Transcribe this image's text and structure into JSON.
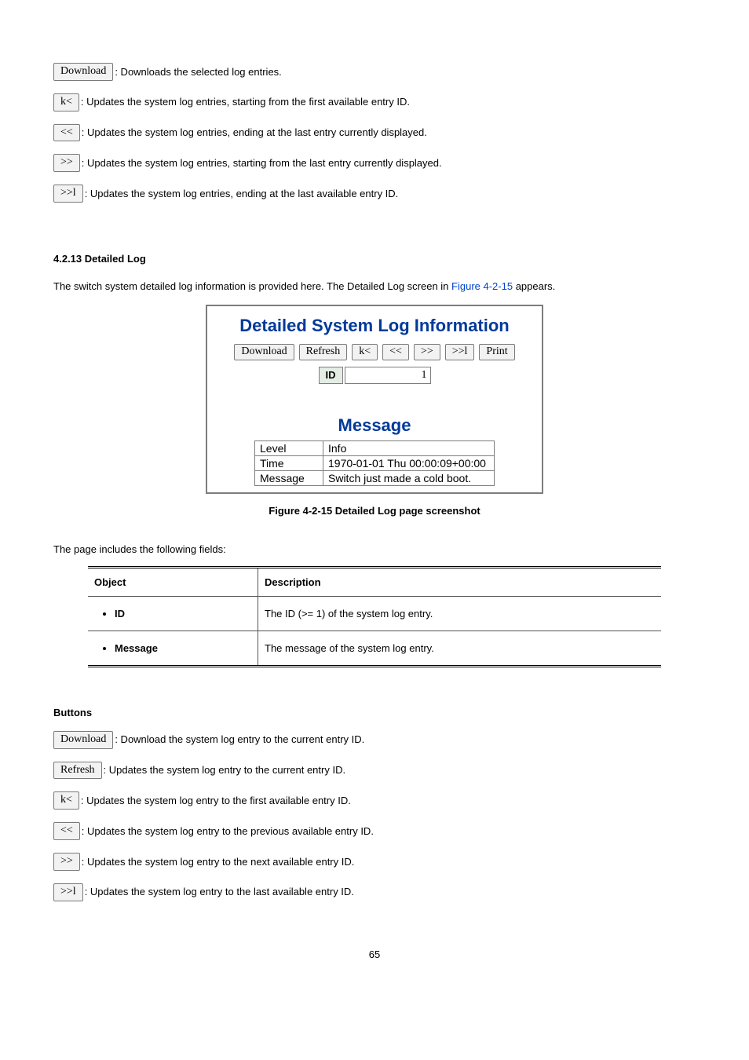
{
  "top_buttons": [
    {
      "label": "Download",
      "desc": ": Downloads the selected log entries."
    },
    {
      "label": "k<",
      "desc": ": Updates the system log entries, starting from the first available entry ID."
    },
    {
      "label": "<<",
      "desc": ": Updates the system log entries, ending at the last entry currently displayed."
    },
    {
      "label": ">>",
      "desc": ": Updates the system log entries, starting from the last entry currently displayed."
    },
    {
      "label": ">>l",
      "desc": ": Updates the system log entries, ending at the last available entry ID."
    }
  ],
  "section_heading": "4.2.13 Detailed Log",
  "intro_prefix": "The switch system detailed log information is provided here. The Detailed Log screen in ",
  "intro_link": "Figure 4-2-15",
  "intro_suffix": " appears.",
  "screenshot": {
    "title": "Detailed System Log Information",
    "buttons": [
      "Download",
      "Refresh",
      "k<",
      "<<",
      ">>",
      ">>l",
      "Print"
    ],
    "id_label": "ID",
    "id_value": "1",
    "message_heading": "Message",
    "rows": [
      {
        "k": "Level",
        "v": "Info"
      },
      {
        "k": "Time",
        "v": "1970-01-01 Thu 00:00:09+00:00"
      },
      {
        "k": "Message",
        "v": "Switch just made a cold boot."
      }
    ]
  },
  "figure_caption_prefix": "Figure 4-2-15 ",
  "figure_caption": "Detailed Log page screenshot",
  "fields_intro": "The page includes the following fields:",
  "field_table": {
    "headers": [
      "Object",
      "Description"
    ],
    "rows": [
      {
        "obj": "ID",
        "desc": "The ID (>= 1) of the system log entry."
      },
      {
        "obj": "Message",
        "desc": "The message of the system log entry."
      }
    ]
  },
  "buttons_heading": "Buttons",
  "bottom_buttons": [
    {
      "label": "Download",
      "desc": ": Download the system log entry to the current entry ID."
    },
    {
      "label": "Refresh",
      "desc": ": Updates the system log entry to the current entry ID."
    },
    {
      "label": "k<",
      "desc": ": Updates the system log entry to the first available entry ID."
    },
    {
      "label": "<<",
      "desc": ": Updates the system log entry to the previous available entry ID."
    },
    {
      "label": ">>",
      "desc": ": Updates the system log entry to the next available entry ID."
    },
    {
      "label": ">>l",
      "desc": ": Updates the system log entry to the last available entry ID."
    }
  ],
  "page_number": "65"
}
